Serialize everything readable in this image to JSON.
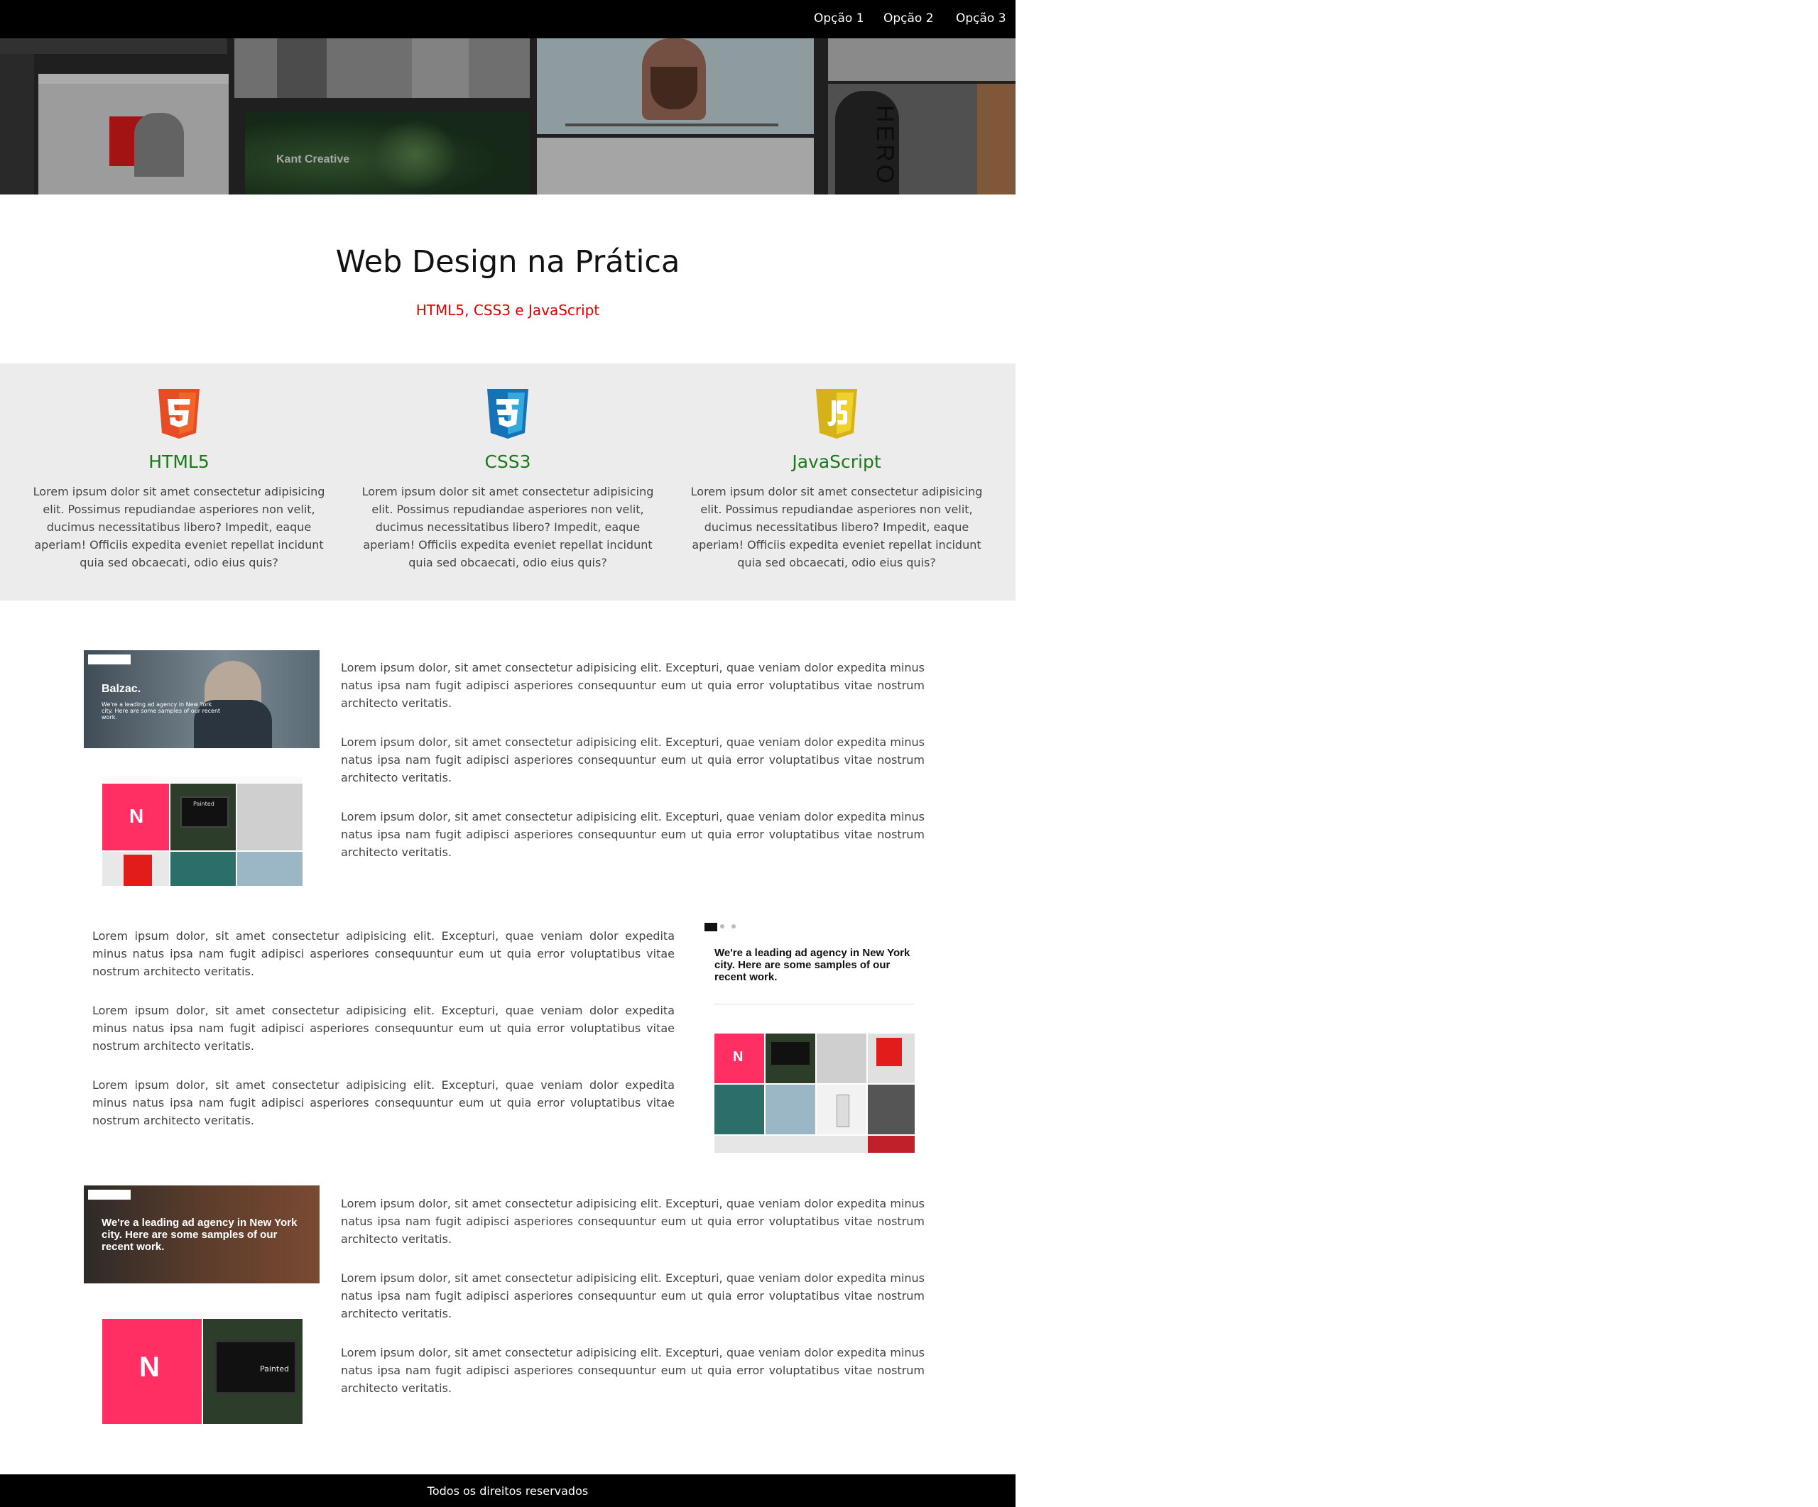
{
  "nav": {
    "items": [
      "Opção 1",
      "Opção 2",
      "Opção 3"
    ]
  },
  "hero": {
    "caption": "Kant Creative"
  },
  "intro": {
    "title": "Web Design na Prática",
    "subtitle": "HTML5, CSS3 e JavaScript"
  },
  "features": [
    {
      "icon": "html5-icon",
      "title": "HTML5",
      "color": "#e44d26",
      "text": "Lorem ipsum dolor sit amet consectetur adipisicing elit. Possimus repudiandae asperiores non velit, ducimus necessitatibus libero? Impedit, eaque aperiam! Officiis expedita eveniet repellat incidunt quia sed obcaecati, odio eius quis?"
    },
    {
      "icon": "css3-icon",
      "title": "CSS3",
      "color": "#2965f1",
      "text": "Lorem ipsum dolor sit amet consectetur adipisicing elit. Possimus repudiandae asperiores non velit, ducimus necessitatibus libero? Impedit, eaque aperiam! Officiis expedita eveniet repellat incidunt quia sed obcaecati, odio eius quis?"
    },
    {
      "icon": "javascript-icon",
      "title": "JavaScript",
      "color": "#e8c21a",
      "text": "Lorem ipsum dolor sit amet consectetur adipisicing elit. Possimus repudiandae asperiores non velit, ducimus necessitatibus libero? Impedit, eaque aperiam! Officiis expedita eveniet repellat incidunt quia sed obcaecati, odio eius quis?"
    }
  ],
  "paragraph": "Lorem ipsum dolor, sit amet consectetur adipisicing elit. Excepturi, quae veniam dolor expedita minus natus ipsa nam fugit adipisci asperiores consequuntur eum ut quia error voluptatibus vitae nostrum architecto veritatis.",
  "sections": [
    {
      "image_text": "Balzac.",
      "image_sub": "We're a leading ad agency in New York city. Here are some samples of our recent work."
    },
    {
      "image_text": "We're a leading ad agency in New York city. Here are some samples of our recent work."
    },
    {
      "image_text": "We're a leading ad agency in New York city. Here are some samples of our recent work."
    }
  ],
  "tiles": {
    "n": "N",
    "painted": "Painted",
    "hero_letters": "HERO"
  },
  "footer": {
    "text": "Todos os direitos reservados"
  }
}
